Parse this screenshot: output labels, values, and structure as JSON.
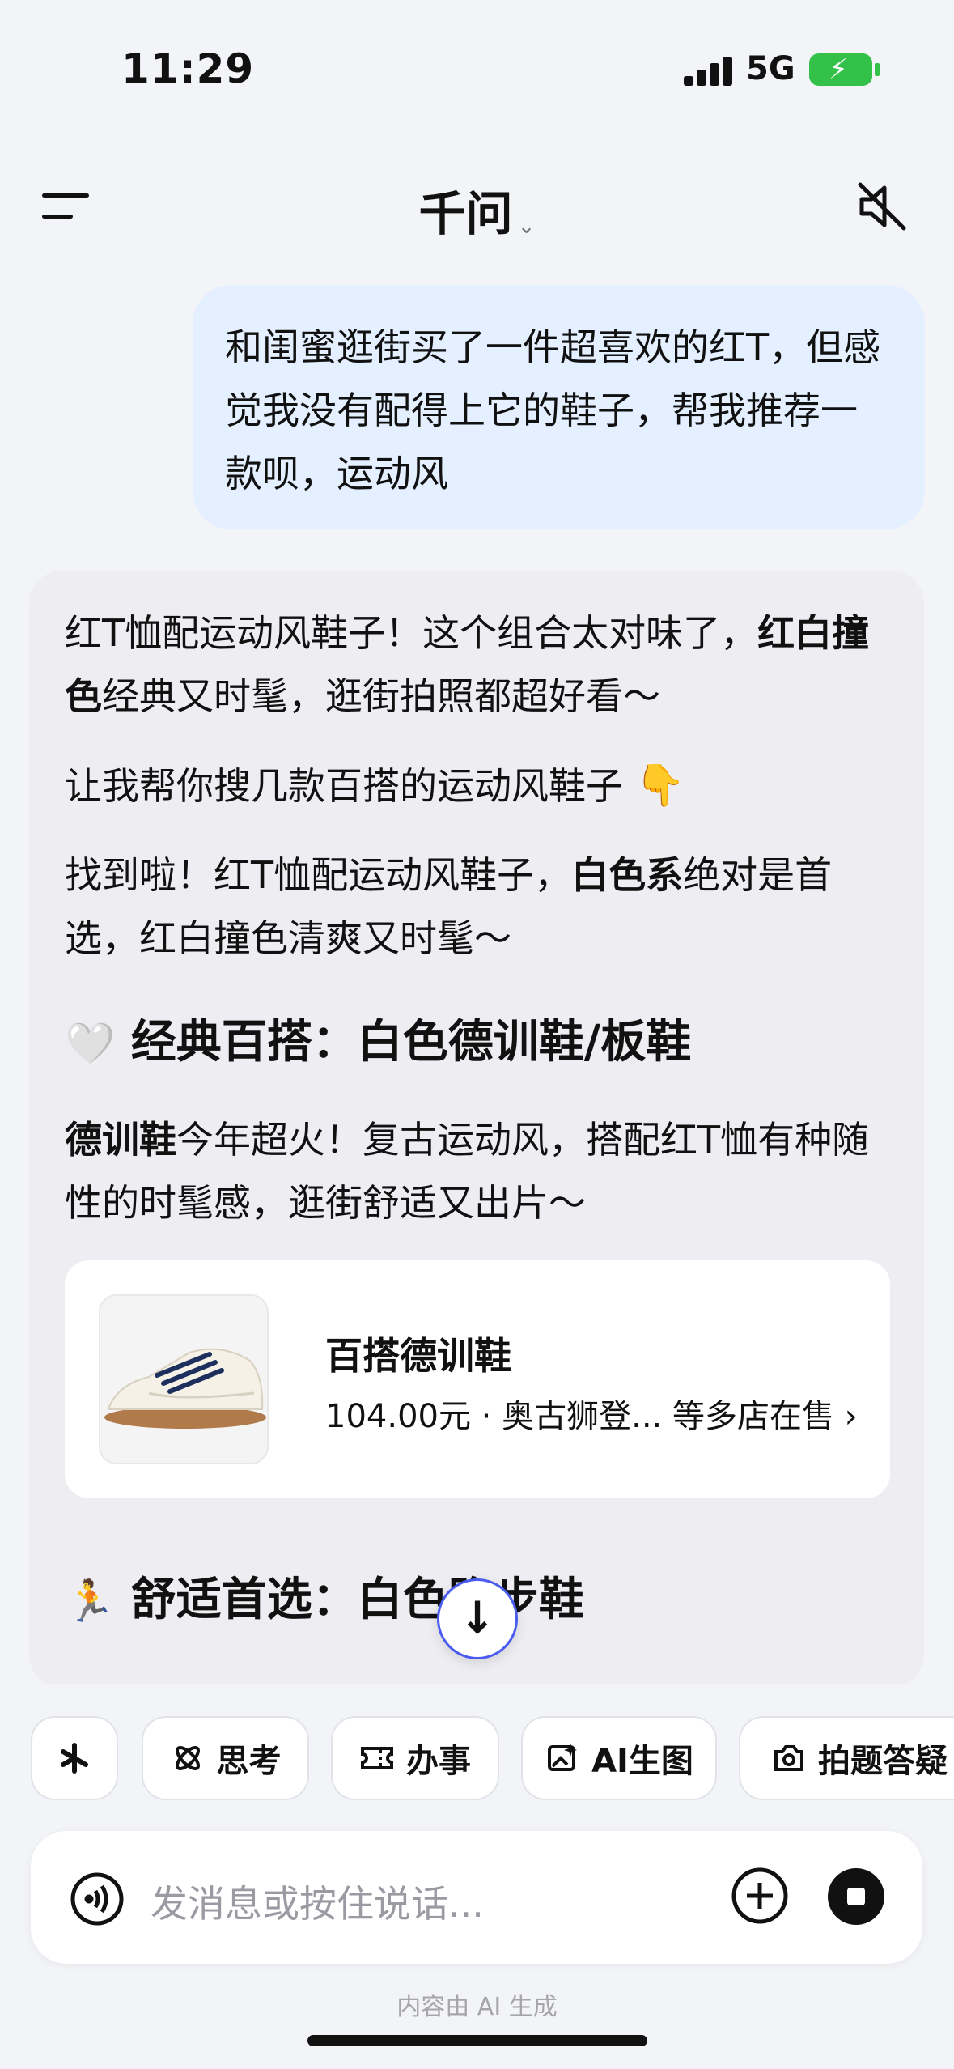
{
  "status_bar": {
    "time": "11:29",
    "network": "5G",
    "battery_color": "#33c14a"
  },
  "header": {
    "title": "千问",
    "menu_icon": "menu-icon",
    "mute_icon": "speaker-muted-icon"
  },
  "user_message": {
    "text": "和闺蜜逛街买了一件超喜欢的红T，但感觉我没有配得上它的鞋子，帮我推荐一款呗，运动风"
  },
  "assistant": {
    "p1_part1": "红T恤配运动风鞋子！这个组合太对味了，",
    "p1_bold": "红白撞色",
    "p1_part2": "经典又时髦，逛街拍照都超好看～",
    "p2": "让我帮你搜几款百搭的运动风鞋子",
    "p2_emoji": "👇",
    "p3_part1": "找到啦！红T恤配运动风鞋子，",
    "p3_bold": "白色系",
    "p3_part2": "绝对是首选，红白撞色清爽又时髦～",
    "section1_emoji": "🤍",
    "section1_title": "经典百搭：白色德训鞋/板鞋",
    "p4_bold": "德训鞋",
    "p4_rest": "今年超火！复古运动风，搭配红T恤有种随性的时髦感，逛街舒适又出片～",
    "product": {
      "name": "百搭德训鞋",
      "meta": "104.00元 · 奥古狮登... 等多店在售 ›"
    },
    "section2_emoji": "🏃",
    "section2_title": "舒适首选：白色跑步鞋"
  },
  "tools": [
    {
      "label": "",
      "icon": "sparkle-icon"
    },
    {
      "label": "思考",
      "icon": "atom-icon"
    },
    {
      "label": "办事",
      "icon": "ticket-icon"
    },
    {
      "label": "AI生图",
      "icon": "image-icon"
    },
    {
      "label": "拍题答疑",
      "icon": "camera-icon"
    }
  ],
  "input": {
    "placeholder": "发消息或按住说话..."
  },
  "footer": {
    "note": "内容由 AI 生成"
  },
  "colors": {
    "accent": "#4a5cf0",
    "user_bubble": "#e4efff"
  }
}
